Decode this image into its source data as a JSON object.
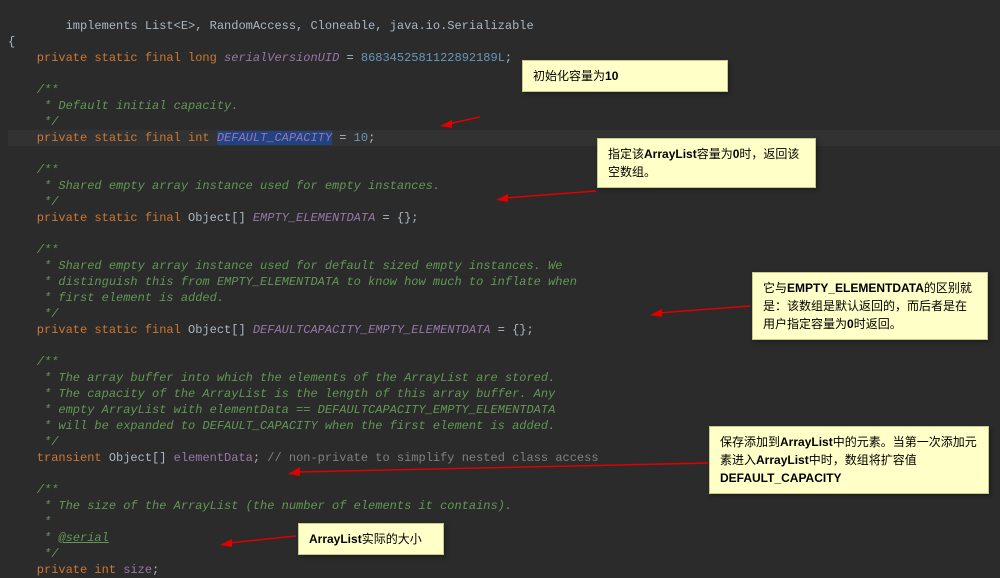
{
  "code": {
    "l1": "        implements List<E>, RandomAccess, Cloneable, java.io.Serializable",
    "l2": "{",
    "l3_pre": "    private static final long ",
    "l3_field": "serialVersionUID",
    "l3_eq": " = ",
    "l3_num": "8683452581122892189L",
    "l3_end": ";",
    "c1a": "    /**",
    "c1b": "     * Default initial capacity.",
    "c1c": "     */",
    "l4_pre": "    private static final int ",
    "l4_field": "DEFAULT_CAPACITY",
    "l4_eq": " = ",
    "l4_num": "10",
    "l4_end": ";",
    "c2a": "    /**",
    "c2b": "     * Shared empty array instance used for empty instances.",
    "c2c": "     */",
    "l5_pre": "    private static final ",
    "l5_type": "Object[] ",
    "l5_field": "EMPTY_ELEMENTDATA",
    "l5_end": " = {};",
    "c3a": "    /**",
    "c3b": "     * Shared empty array instance used for default sized empty instances. We",
    "c3c": "     * distinguish this from EMPTY_ELEMENTDATA to know how much to inflate when",
    "c3d": "     * first element is added.",
    "c3e": "     */",
    "l6_pre": "    private static final ",
    "l6_type": "Object[] ",
    "l6_field": "DEFAULTCAPACITY_EMPTY_ELEMENTDATA",
    "l6_end": " = {};",
    "c4a": "    /**",
    "c4b": "     * The array buffer into which the elements of the ArrayList are stored.",
    "c4c": "     * The capacity of the ArrayList is the length of this array buffer. Any",
    "c4d": "     * empty ArrayList with elementData == DEFAULTCAPACITY_EMPTY_ELEMENTDATA",
    "c4e": "     * will be expanded to DEFAULT_CAPACITY when the first element is added.",
    "c4f": "     */",
    "l7_pre": "    transient ",
    "l7_type": "Object[] ",
    "l7_field": "elementData",
    "l7_end": "; ",
    "l7_comment": "// non-private to simplify nested class access",
    "c5a": "    /**",
    "c5b": "     * The size of the ArrayList (the number of elements it contains).",
    "c5c": "     *",
    "c5d_pre": "     * ",
    "c5d_tag": "@serial",
    "c5e": "     */",
    "l8_pre": "    private int ",
    "l8_field": "size",
    "l8_end": ";"
  },
  "notes": {
    "n1": "初始化容量为",
    "n1b": "10",
    "n2a": "指定该",
    "n2b": "ArrayList",
    "n2c": "容量为",
    "n2d": "0",
    "n2e": "时，返回该空数组。",
    "n3a": "它与",
    "n3b": "EMPTY_ELEMENTDATA",
    "n3c": "的区别就是：该数组是默认返回的，而后者是在用户指定容量为",
    "n3d": "0",
    "n3e": "时返回。",
    "n4a": "保存添加到",
    "n4b": "ArrayList",
    "n4c": "中的元素。当第一次添加元素进入",
    "n4d": "ArrayList",
    "n4e": "中时，数组将扩容值",
    "n4f": "DEFAULT_CAPACITY",
    "n5a": "ArrayList",
    "n5b": "实际的大小"
  }
}
